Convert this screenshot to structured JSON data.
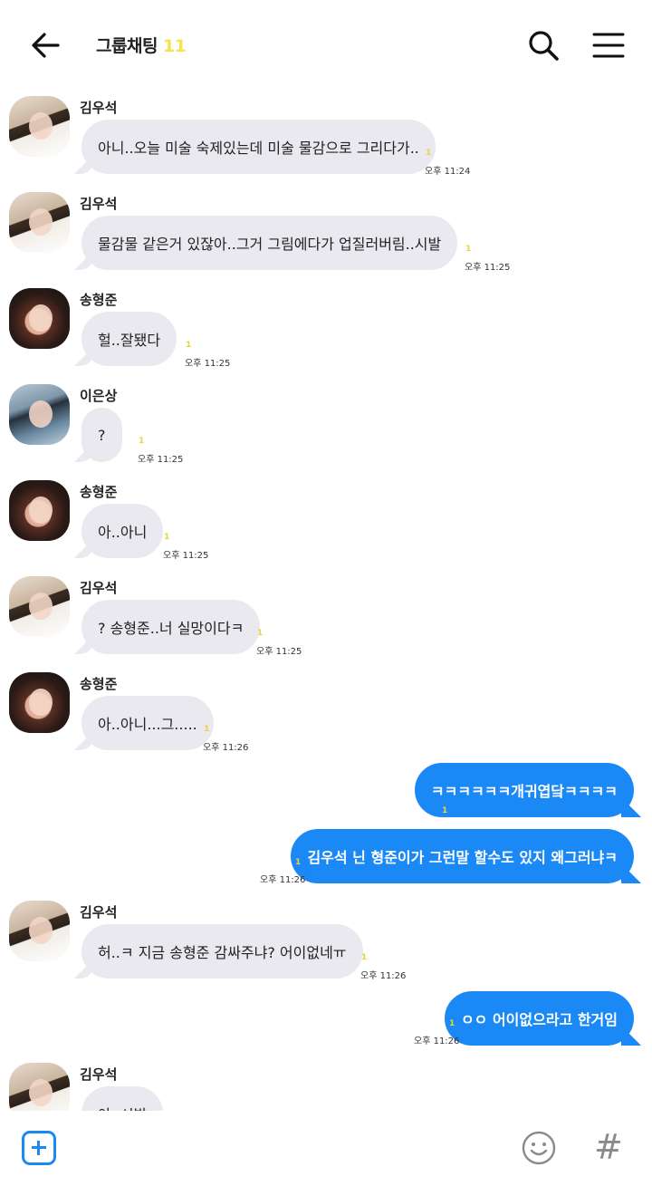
{
  "header": {
    "title": "그룹채팅",
    "member_count": "11"
  },
  "messages": [
    {
      "sender": "김우석",
      "avatar": "kim",
      "text": "아니..오늘 미술 숙제있는데 미술 물감으로 그리다가..",
      "unread": "1",
      "time": "오후 11:24"
    },
    {
      "sender": "김우석",
      "avatar": "kim",
      "text": "물감물 같은거 있잖아..그거 그림에다가 업질러버림..시발",
      "unread": "1",
      "time": "오후 11:25"
    },
    {
      "sender": "송형준",
      "avatar": "song",
      "text": "헐..잘됐다",
      "unread": "1",
      "time": "오후 11:25"
    },
    {
      "sender": "이은상",
      "avatar": "lee",
      "text": "?",
      "unread": "1",
      "time": "오후 11:25"
    },
    {
      "sender": "송형준",
      "avatar": "song",
      "text": "아..아니",
      "unread": "1",
      "time": "오후 11:25"
    },
    {
      "sender": "김우석",
      "avatar": "kim",
      "text": "? 송형준..너 실망이다ㅋ",
      "unread": "1",
      "time": "오후 11:25"
    },
    {
      "sender": "송형준",
      "avatar": "song",
      "text": "아..아니...그.....",
      "unread": "1",
      "time": "오후 11:26"
    },
    {
      "out": true,
      "text": "ㅋㅋㅋㅋㅋㅋ개귀엽닼ㅋㅋㅋㅋ",
      "unread": "1"
    },
    {
      "out": true,
      "text": "김우석 닌 형준이가 그런말 할수도 있지 왜그러냐ㅋ",
      "unread": "1",
      "time": "오후 11:26"
    },
    {
      "sender": "김우석",
      "avatar": "kim",
      "text": "허..ㅋ 지금 송형준 감싸주냐? 어이없네ㅠ",
      "unread": "1",
      "time": "오후 11:26"
    },
    {
      "out": true,
      "text": "ㅇㅇ 어이없으라고 한거임",
      "unread": "1",
      "time": "오후 11:26"
    },
    {
      "sender": "김우석",
      "avatar": "kim",
      "text": "아..시발"
    }
  ],
  "icons": {
    "back": "arrow-left-icon",
    "search": "search-icon",
    "menu": "hamburger-menu-icon",
    "plus": "plus-square-icon",
    "emoji": "smiley-icon",
    "hashtag": "hashtag-icon"
  },
  "footer": {
    "hashtag_glyph": "#"
  },
  "colors": {
    "outgoing_bubble": "#1a88f5",
    "incoming_bubble": "#e9e9ef",
    "unread": "#e8d53a",
    "member_count": "#f5e44a"
  }
}
